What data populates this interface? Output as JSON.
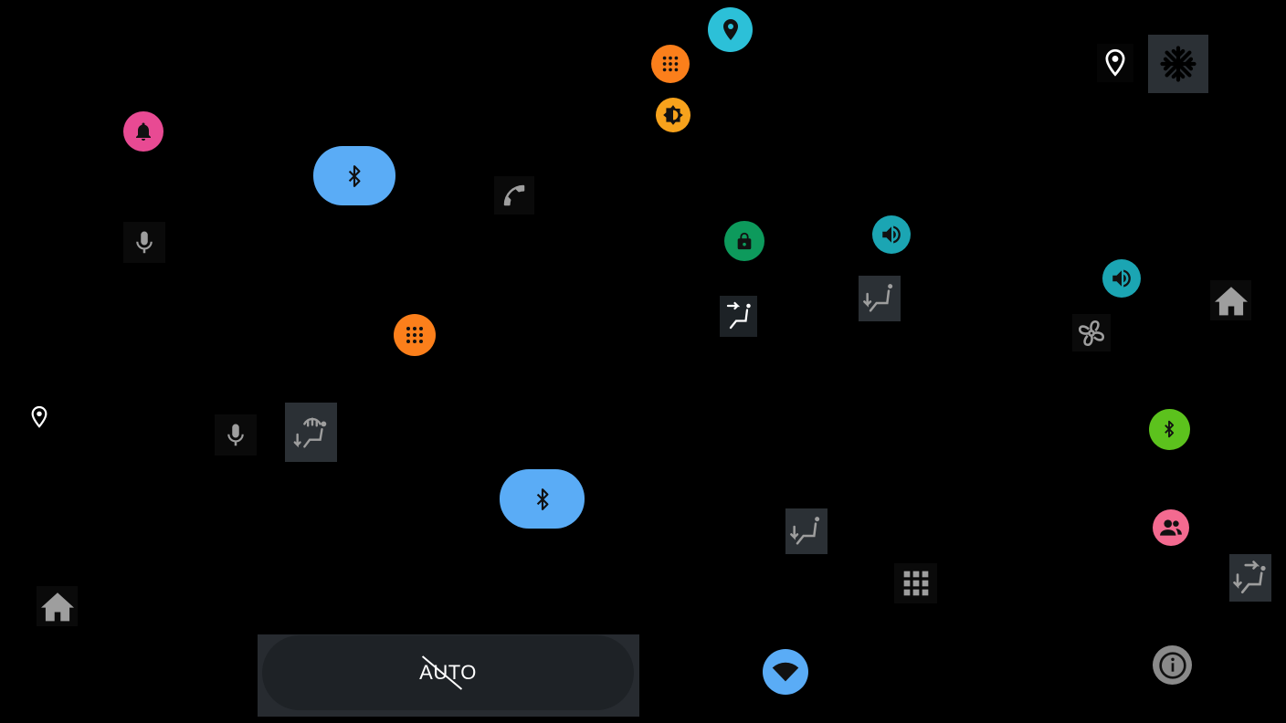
{
  "screen": {
    "background": "#000000"
  },
  "colors": {
    "pink": "#e84a93",
    "blue": "#5aacf6",
    "orange": "#fb7f1b",
    "amber": "#f7a21c",
    "cyan": "#2cc0d8",
    "teal": "#1ba5b3",
    "green": "#0d9a5c",
    "lime": "#5cc21d",
    "rose": "#f36a90",
    "gray_icon": "#9e9e9e",
    "tile_gray": "#2b3035"
  },
  "controls": {
    "auto_button": {
      "label": "AUTO",
      "disabled_slash": true
    }
  },
  "icons": [
    "notification-bell-icon",
    "bluetooth-icon",
    "phone-icon",
    "microphone-icon",
    "app-grid-icon",
    "brightness-icon",
    "location-pin-icon",
    "snowflake-icon",
    "lock-icon",
    "volume-icon",
    "seat-heat-icon",
    "fan-icon",
    "home-icon",
    "defrost-seat-icon",
    "people-icon",
    "wifi-icon",
    "info-icon"
  ]
}
